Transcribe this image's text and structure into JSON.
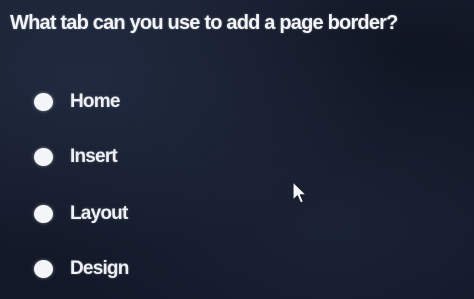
{
  "quiz": {
    "question": "What tab can you use to add a page border?",
    "options": [
      {
        "label": "Home"
      },
      {
        "label": "Insert"
      },
      {
        "label": "Layout"
      },
      {
        "label": "Design"
      }
    ]
  },
  "icons": {
    "radio": "radio-button-icon",
    "cursor": "mouse-pointer-icon"
  },
  "colors": {
    "background": "#141a2a",
    "text": "#f2f4f8",
    "radio": "#f4f5f8"
  }
}
